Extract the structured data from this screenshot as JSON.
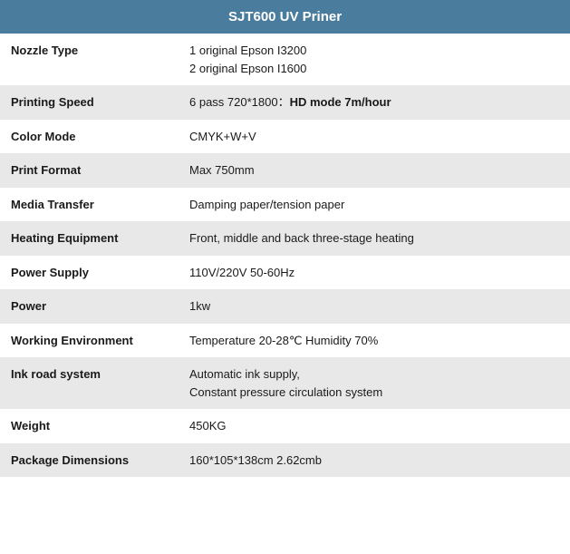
{
  "header": {
    "title": "SJT600 UV Priner"
  },
  "rows": [
    {
      "id": "nozzle-type",
      "label": "Nozzle Type",
      "value": "1 original Epson I3200\n2 original Epson I1600",
      "shade": "light",
      "multiline": true,
      "bold_segment": null
    },
    {
      "id": "printing-speed",
      "label": "Printing Speed",
      "value_prefix": "6 pass 720*1800：",
      "value_bold": "HD mode 7m/hour",
      "shade": "dark",
      "multiline": false,
      "bold_segment": true
    },
    {
      "id": "color-mode",
      "label": "Color Mode",
      "value": "CMYK+W+V",
      "shade": "light",
      "multiline": false,
      "bold_segment": null
    },
    {
      "id": "print-format",
      "label": "Print Format",
      "value": "Max 750mm",
      "shade": "dark",
      "multiline": false,
      "bold_segment": null
    },
    {
      "id": "media-transfer",
      "label": "Media Transfer",
      "value": "Damping paper/tension paper",
      "shade": "light",
      "multiline": false,
      "bold_segment": null
    },
    {
      "id": "heating-equipment",
      "label": "Heating Equipment",
      "value": "Front, middle and back three-stage heating",
      "shade": "dark",
      "multiline": false,
      "bold_segment": null
    },
    {
      "id": "power-supply",
      "label": "Power Supply",
      "value": "110V/220V 50-60Hz",
      "shade": "light",
      "multiline": false,
      "bold_segment": null
    },
    {
      "id": "power",
      "label": "Power",
      "value": "1kw",
      "shade": "dark",
      "multiline": false,
      "bold_segment": null
    },
    {
      "id": "working-environment",
      "label": "Working Environment",
      "value": "Temperature 20-28℃ Humidity 70%",
      "shade": "light",
      "multiline": false,
      "bold_segment": null
    },
    {
      "id": "ink-road-system",
      "label": "Ink road system",
      "value": "Automatic ink supply,\nConstant pressure circulation system",
      "shade": "dark",
      "multiline": true,
      "bold_segment": null
    },
    {
      "id": "weight",
      "label": "Weight",
      "value": "450KG",
      "shade": "light",
      "multiline": false,
      "bold_segment": null
    },
    {
      "id": "package-dimensions",
      "label": "Package Dimensions",
      "value": "160*105*138cm 2.62cmb",
      "shade": "dark",
      "multiline": false,
      "bold_segment": null
    }
  ]
}
